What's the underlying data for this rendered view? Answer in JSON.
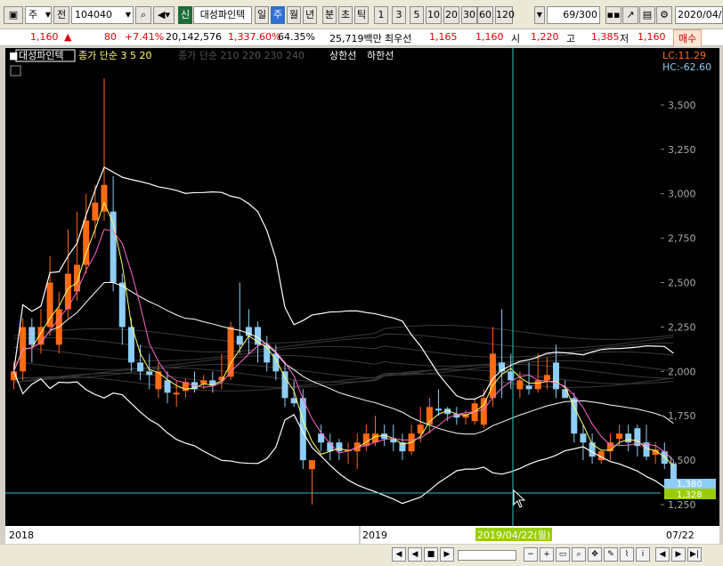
{
  "toolbar": {
    "type_select": "주",
    "kind": "전",
    "code": "104040",
    "badge": "신",
    "name": "대성파인텍",
    "periods": [
      "일",
      "주",
      "월",
      "년"
    ],
    "active_period": "주",
    "minute_opts": [
      "분",
      "초",
      "틱"
    ],
    "nums": [
      "1",
      "3",
      "5",
      "10",
      "20",
      "30",
      "60",
      "120"
    ],
    "count": "69",
    "count_total": "/300",
    "date": "2020/04/"
  },
  "quote": {
    "price": "1,160",
    "arrow": "▲",
    "change": "80",
    "pct": "+7.41%",
    "volume": "20,142,576",
    "vol_pct": "1,337.60%",
    "turnover": "64.35%",
    "amount": "25,719백만",
    "best_label": "최우선",
    "ask": "1,165",
    "bid": "1,160",
    "open_label": "시",
    "open": "1,220",
    "high_label": "고",
    "high": "1,385",
    "low_label": "저",
    "low": "1,160",
    "buy_label": "매수"
  },
  "legend": {
    "name": "대성파인텍",
    "ma": "종가 단순 3  5  20",
    "ma2": "종가 단순 210  220  230  240",
    "upper": "상한선",
    "lower": "하한선",
    "lc": "LC:11.29",
    "hc": "HC:-62.60"
  },
  "chart_data": {
    "type": "candlestick",
    "yticks": [
      "3,500",
      "3,250",
      "3,000",
      "2,750",
      "2,500",
      "2,250",
      "2,000",
      "1,750",
      "1,500",
      "1,250"
    ],
    "ylim": [
      1150,
      3650
    ],
    "xlabels": [
      "2018",
      "2019",
      "07/22"
    ],
    "crosshair_date": "2019/04/22(월)",
    "price_tags": [
      "1,380",
      "1,328"
    ],
    "colors": {
      "up": "#ff6a13",
      "down": "#8ecdf5"
    },
    "candles": [
      {
        "o": 1950,
        "c": 2000,
        "h": 2050,
        "l": 1900
      },
      {
        "o": 2000,
        "c": 2250,
        "h": 2300,
        "l": 1950
      },
      {
        "o": 2250,
        "c": 2150,
        "h": 2300,
        "l": 2050
      },
      {
        "o": 2150,
        "c": 2250,
        "h": 2350,
        "l": 2100
      },
      {
        "o": 2250,
        "c": 2500,
        "h": 2650,
        "l": 2200
      },
      {
        "o": 2150,
        "c": 2350,
        "h": 2450,
        "l": 2100
      },
      {
        "o": 2350,
        "c": 2550,
        "h": 2800,
        "l": 2300
      },
      {
        "o": 2450,
        "c": 2600,
        "h": 2900,
        "l": 2400
      },
      {
        "o": 2600,
        "c": 2850,
        "h": 3000,
        "l": 2550
      },
      {
        "o": 2850,
        "c": 2950,
        "h": 3050,
        "l": 2750
      },
      {
        "o": 2900,
        "c": 3050,
        "h": 3650,
        "l": 2850
      },
      {
        "o": 2900,
        "c": 2500,
        "h": 3100,
        "l": 2450
      },
      {
        "o": 2500,
        "c": 2250,
        "h": 2550,
        "l": 2150
      },
      {
        "o": 2250,
        "c": 2050,
        "h": 2300,
        "l": 2000
      },
      {
        "o": 2050,
        "c": 2000,
        "h": 2150,
        "l": 1950
      },
      {
        "o": 2000,
        "c": 1980,
        "h": 2100,
        "l": 1900
      },
      {
        "o": 1900,
        "c": 2000,
        "h": 2050,
        "l": 1850
      },
      {
        "o": 1950,
        "c": 1880,
        "h": 2000,
        "l": 1820
      },
      {
        "o": 1870,
        "c": 1880,
        "h": 1950,
        "l": 1800
      },
      {
        "o": 1890,
        "c": 1940,
        "h": 1960,
        "l": 1850
      },
      {
        "o": 1940,
        "c": 1900,
        "h": 2000,
        "l": 1880
      },
      {
        "o": 1930,
        "c": 1950,
        "h": 1980,
        "l": 1900
      },
      {
        "o": 1950,
        "c": 1920,
        "h": 2000,
        "l": 1880
      },
      {
        "o": 1950,
        "c": 1970,
        "h": 2100,
        "l": 1900
      },
      {
        "o": 1970,
        "c": 2250,
        "h": 2280,
        "l": 1950
      },
      {
        "o": 2200,
        "c": 2150,
        "h": 2500,
        "l": 2100
      },
      {
        "o": 2250,
        "c": 2200,
        "h": 2350,
        "l": 2100
      },
      {
        "o": 2250,
        "c": 2150,
        "h": 2280,
        "l": 2050
      },
      {
        "o": 2150,
        "c": 2050,
        "h": 2200,
        "l": 2000
      },
      {
        "o": 2100,
        "c": 2000,
        "h": 2150,
        "l": 1950
      },
      {
        "o": 2000,
        "c": 1850,
        "h": 2050,
        "l": 1800
      },
      {
        "o": 1850,
        "c": 1820,
        "h": 1950,
        "l": 1800
      },
      {
        "o": 1850,
        "c": 1500,
        "h": 1900,
        "l": 1450
      },
      {
        "o": 1450,
        "c": 1500,
        "h": 1500,
        "l": 1250
      },
      {
        "o": 1650,
        "c": 1600,
        "h": 1700,
        "l": 1550
      },
      {
        "o": 1600,
        "c": 1550,
        "h": 1650,
        "l": 1500
      },
      {
        "o": 1600,
        "c": 1550,
        "h": 1620,
        "l": 1500
      },
      {
        "o": 1550,
        "c": 1560,
        "h": 1600,
        "l": 1480
      },
      {
        "o": 1550,
        "c": 1600,
        "h": 1650,
        "l": 1450
      },
      {
        "o": 1580,
        "c": 1650,
        "h": 1700,
        "l": 1550
      },
      {
        "o": 1600,
        "c": 1650,
        "h": 1750,
        "l": 1580
      },
      {
        "o": 1650,
        "c": 1620,
        "h": 1700,
        "l": 1580
      },
      {
        "o": 1620,
        "c": 1600,
        "h": 1700,
        "l": 1550
      },
      {
        "o": 1600,
        "c": 1550,
        "h": 1650,
        "l": 1500
      },
      {
        "o": 1550,
        "c": 1650,
        "h": 1700,
        "l": 1530
      },
      {
        "o": 1650,
        "c": 1700,
        "h": 1800,
        "l": 1600
      },
      {
        "o": 1700,
        "c": 1800,
        "h": 1850,
        "l": 1650
      },
      {
        "o": 1790,
        "c": 1780,
        "h": 1900,
        "l": 1750
      },
      {
        "o": 1790,
        "c": 1760,
        "h": 1800,
        "l": 1720
      },
      {
        "o": 1760,
        "c": 1740,
        "h": 1800,
        "l": 1700
      },
      {
        "o": 1740,
        "c": 1760,
        "h": 1780,
        "l": 1700
      },
      {
        "o": 1720,
        "c": 1820,
        "h": 1850,
        "l": 1700
      },
      {
        "o": 1700,
        "c": 1850,
        "h": 1900,
        "l": 1680
      },
      {
        "o": 1850,
        "c": 2100,
        "h": 2250,
        "l": 1800
      },
      {
        "o": 2050,
        "c": 2000,
        "h": 2350,
        "l": 1850
      },
      {
        "o": 2000,
        "c": 1950,
        "h": 2100,
        "l": 1900
      },
      {
        "o": 1900,
        "c": 1950,
        "h": 2000,
        "l": 1850
      },
      {
        "o": 1920,
        "c": 1900,
        "h": 2050,
        "l": 1870
      },
      {
        "o": 1900,
        "c": 1950,
        "h": 2100,
        "l": 1880
      },
      {
        "o": 1950,
        "c": 1980,
        "h": 2080,
        "l": 1900
      },
      {
        "o": 2050,
        "c": 1900,
        "h": 2150,
        "l": 1850
      },
      {
        "o": 1900,
        "c": 1850,
        "h": 1950,
        "l": 1850
      },
      {
        "o": 1850,
        "c": 1650,
        "h": 1880,
        "l": 1600
      },
      {
        "o": 1650,
        "c": 1600,
        "h": 1700,
        "l": 1500
      },
      {
        "o": 1600,
        "c": 1520,
        "h": 1650,
        "l": 1480
      },
      {
        "o": 1500,
        "c": 1550,
        "h": 1560,
        "l": 1480
      },
      {
        "o": 1550,
        "c": 1600,
        "h": 1650,
        "l": 1500
      },
      {
        "o": 1620,
        "c": 1650,
        "h": 1700,
        "l": 1580
      },
      {
        "o": 1650,
        "c": 1600,
        "h": 1700,
        "l": 1550
      },
      {
        "o": 1680,
        "c": 1580,
        "h": 1700,
        "l": 1520
      },
      {
        "o": 1600,
        "c": 1520,
        "h": 1700,
        "l": 1500
      },
      {
        "o": 1530,
        "c": 1560,
        "h": 1600,
        "l": 1480
      },
      {
        "o": 1550,
        "c": 1480,
        "h": 1600,
        "l": 1450
      },
      {
        "o": 1480,
        "c": 1360,
        "h": 1500,
        "l": 1340
      }
    ]
  }
}
